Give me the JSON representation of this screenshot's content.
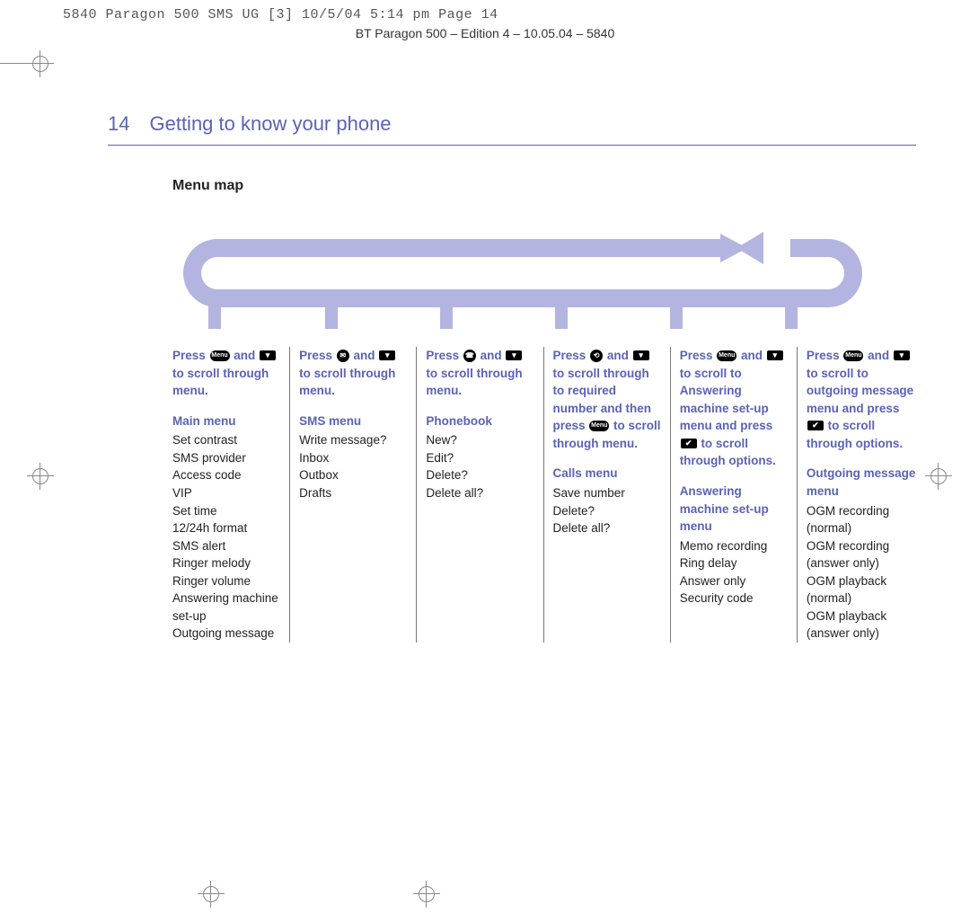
{
  "slug_line": "5840 Paragon 500 SMS UG [3]  10/5/04  5:14 pm  Page 14",
  "edition_line": "BT Paragon 500 – Edition 4 – 10.05.04 – 5840",
  "page_number": "14",
  "page_title": "Getting to know your phone",
  "section_title": "Menu map",
  "columns": [
    {
      "instruction_html": "Press {menu-pill} and {down-rect} to scroll through menu.",
      "menu_name": "Main menu",
      "items": [
        "Set contrast",
        "SMS provider",
        "Access code",
        "VIP",
        "Set time",
        "12/24h format",
        "SMS alert",
        "Ringer melody",
        "Ringer volume",
        "Answering machine set-up",
        "Outgoing message"
      ]
    },
    {
      "instruction_html": "Press {sms-circle} and {down-rect} to scroll through menu.",
      "menu_name": "SMS menu",
      "items": [
        "Write message?",
        "Inbox",
        "Outbox",
        "Drafts"
      ]
    },
    {
      "instruction_html": "Press {pb-circle} and {down-rect} to scroll through menu.",
      "menu_name": "Phonebook",
      "items": [
        "New?",
        "Edit?",
        "Delete?",
        "Delete all?"
      ]
    },
    {
      "instruction_html": "Press {calls-circle} and {down-rect} to scroll through to required number and then press {menu-pill} to scroll through menu.",
      "menu_name": "Calls menu",
      "items": [
        "Save number",
        "Delete?",
        "Delete all?"
      ]
    },
    {
      "instruction_html": "Press {menu-pill} and {down-rect} to scroll to Answering machine set-up menu and press {ok-rect} to scroll through options.",
      "menu_name": "Answering machine set-up menu",
      "items": [
        "Memo recording",
        "Ring delay",
        "Answer only",
        "Security code"
      ]
    },
    {
      "instruction_html": "Press {menu-pill} and {down-rect} to scroll to outgoing message menu and press {ok-rect} to scroll through options.",
      "menu_name": "Outgoing message menu",
      "items": [
        "OGM recording (normal)",
        "OGM recording (answer only)",
        "OGM playback (normal)",
        "OGM playback (answer only)"
      ]
    }
  ]
}
